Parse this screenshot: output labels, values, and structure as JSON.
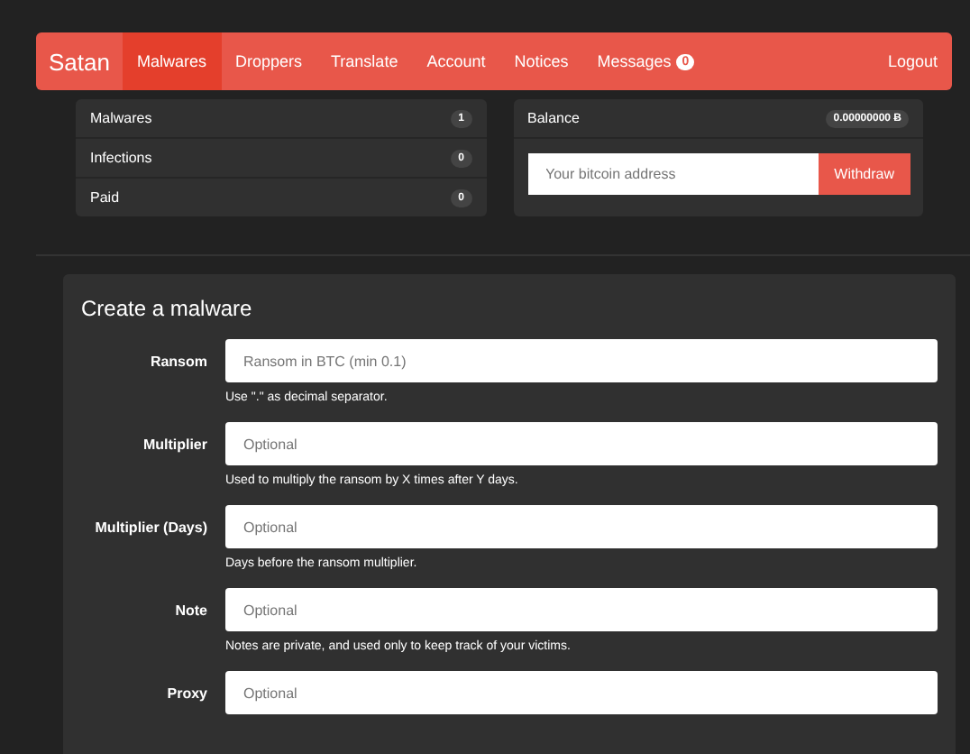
{
  "navbar": {
    "brand": "Satan",
    "items": [
      {
        "label": "Malwares",
        "selected": true
      },
      {
        "label": "Droppers",
        "selected": false
      },
      {
        "label": "Translate",
        "selected": false
      },
      {
        "label": "Account",
        "selected": false
      },
      {
        "label": "Notices",
        "selected": false
      },
      {
        "label": "Messages",
        "selected": false,
        "badge": "0"
      }
    ],
    "logout": "Logout"
  },
  "stats": [
    {
      "label": "Malwares",
      "count": "1"
    },
    {
      "label": "Infections",
      "count": "0"
    },
    {
      "label": "Paid",
      "count": "0"
    }
  ],
  "balance": {
    "label": "Balance",
    "amount": "0.00000000 Ƀ",
    "address_placeholder": "Your bitcoin address",
    "button": "Withdraw"
  },
  "form": {
    "title": "Create a malware",
    "fields": [
      {
        "label": "Ransom",
        "placeholder": "Ransom in BTC (min 0.1)",
        "help": "Use \".\" as decimal separator."
      },
      {
        "label": "Multiplier",
        "placeholder": "Optional",
        "help": "Used to multiply the ransom by X times after Y days."
      },
      {
        "label": "Multiplier (Days)",
        "placeholder": "Optional",
        "help": "Days before the ransom multiplier."
      },
      {
        "label": "Note",
        "placeholder": "Optional",
        "help": "Notes are private, and used only to keep track of your victims."
      },
      {
        "label": "Proxy",
        "placeholder": "Optional"
      }
    ]
  }
}
